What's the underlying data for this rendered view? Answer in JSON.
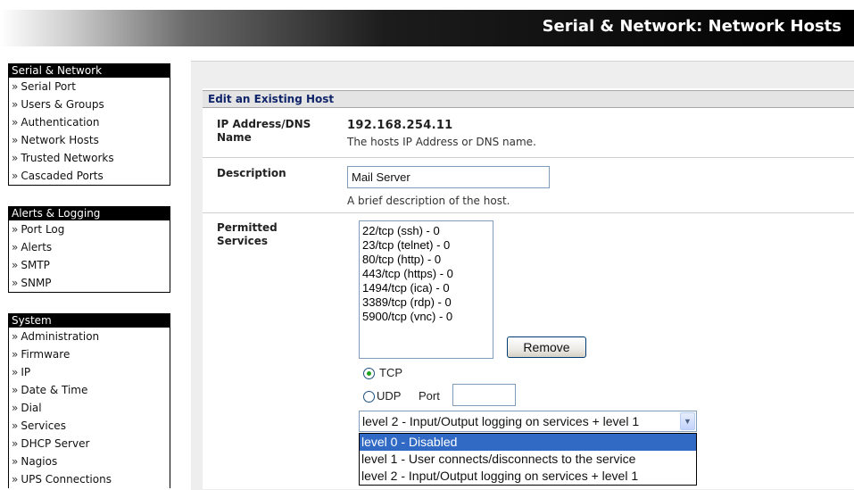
{
  "header": {
    "title": "Serial & Network: Network Hosts"
  },
  "sidebar": {
    "sections": [
      {
        "title": "Serial & Network",
        "items": [
          "Serial Port",
          "Users & Groups",
          "Authentication",
          "Network Hosts",
          "Trusted Networks",
          "Cascaded Ports"
        ]
      },
      {
        "title": "Alerts & Logging",
        "items": [
          "Port Log",
          "Alerts",
          "SMTP",
          "SNMP"
        ]
      },
      {
        "title": "System",
        "items": [
          "Administration",
          "Firmware",
          "IP",
          "Date & Time",
          "Dial",
          "Services",
          "DHCP Server",
          "Nagios",
          "UPS Connections"
        ]
      }
    ],
    "bullet": "»"
  },
  "form": {
    "heading": "Edit an Existing Host",
    "ip": {
      "label": "IP Address/DNS Name",
      "value": "192.168.254.11",
      "help": "The hosts IP Address or DNS name."
    },
    "description": {
      "label": "Description",
      "value": "Mail Server",
      "help": "A brief description of the host."
    },
    "services": {
      "label": "Permitted Services",
      "list": [
        "22/tcp (ssh) - 0",
        "23/tcp (telnet) - 0",
        "80/tcp (http) - 0",
        "443/tcp (https) - 0",
        "1494/tcp (ica) - 0",
        "3389/tcp (rdp) - 0",
        "5900/tcp (vnc) - 0"
      ],
      "remove_button": "Remove",
      "tcp_label": "TCP",
      "udp_label": "UDP",
      "port_label": "Port",
      "port_value": "",
      "selected_protocol": "TCP",
      "log_level_selected": "level 2 - Input/Output logging on services + level 1",
      "log_level_options": [
        "level 0 - Disabled",
        "level 1 - User connects/disconnects to the service",
        "level 2 - Input/Output logging on services + level 1"
      ],
      "highlighted_option": "level 0 - Disabled"
    }
  }
}
